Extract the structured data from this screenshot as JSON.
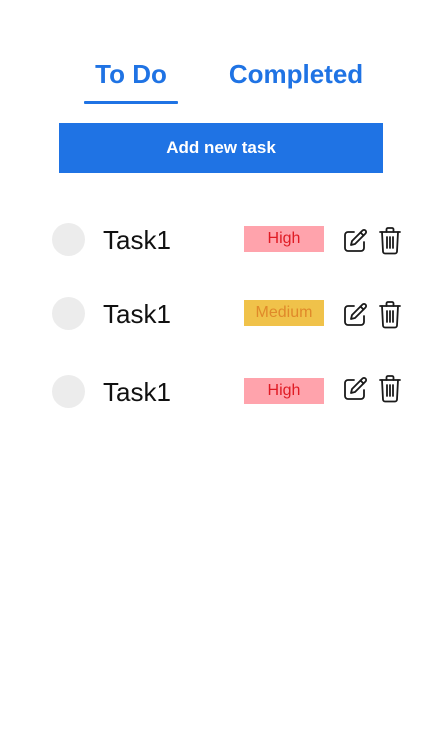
{
  "tabs": {
    "todo_label": "To Do",
    "completed_label": "Completed",
    "active": "todo"
  },
  "actions": {
    "add_label": "Add new task"
  },
  "colors": {
    "accent": "#1f73e4",
    "priority_high_bg": "#ffa3ac",
    "priority_high_text": "#e01b24",
    "priority_medium_bg": "#f0c24a",
    "priority_medium_text": "#e0892a",
    "checkbox": "#ececec"
  },
  "tasks": [
    {
      "title": "Task1",
      "priority": "High",
      "priority_level": "high"
    },
    {
      "title": "Task1",
      "priority": "Medium",
      "priority_level": "medium"
    },
    {
      "title": "Task1",
      "priority": "High",
      "priority_level": "high"
    }
  ],
  "icons": {
    "edit": "pencil-square-icon",
    "delete": "trash-icon"
  }
}
